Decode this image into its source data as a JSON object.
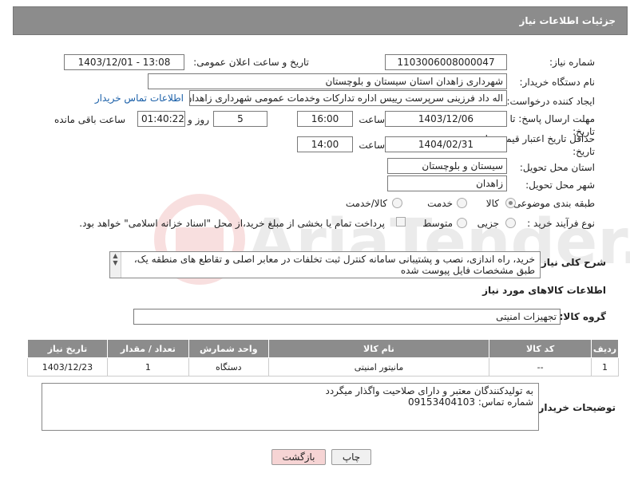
{
  "header": {
    "title": "جزئیات اطلاعات نیاز"
  },
  "fields": {
    "need_number_label": "شماره نیاز:",
    "need_number": "1103006008000047",
    "announce_label": "تاریخ و ساعت اعلان عمومی:",
    "announce_value": "1403/12/01 - 13:08",
    "buyer_label": "نام دستگاه خریدار:",
    "buyer_value": "شهرداری زاهدان استان سیستان و بلوچستان",
    "creator_label": "ایجاد کننده درخواست:",
    "creator_value": "اله داد فرزینی سرپرست رییس اداره تدارکات وخدمات عمومی شهرداری زاهدان ا",
    "contact_link": "اطلاعات تماس خریدار",
    "reply_deadline_label": "مهلت ارسال پاسخ: تا تاریخ:",
    "reply_date": "1403/12/06",
    "time_label": "ساعت",
    "reply_time": "16:00",
    "days_value": "5",
    "day_and_label": "روز و",
    "remaining_time": "01:40:22",
    "remaining_label": "ساعت باقی مانده",
    "price_validity_label": "حداقل تاریخ اعتبار قیمت: تا تاریخ:",
    "price_date": "1404/02/31",
    "price_time": "14:00",
    "province_label": "استان محل تحویل:",
    "province_value": "سیستان و بلوچستان",
    "city_label": "شهر محل تحویل:",
    "city_value": "زاهدان",
    "category_label": "طبقه بندی موضوعی:",
    "category_options": [
      "کالا",
      "خدمت",
      "کالا/خدمت"
    ],
    "category_selected": "کالا",
    "process_label": "نوع فرآیند خرید :",
    "process_options": [
      "جزیی",
      "متوسط"
    ],
    "payment_note": "پرداخت تمام یا بخشی از مبلغ خرید،از محل \"اسناد خزانه اسلامی\" خواهد بود."
  },
  "description": {
    "label": "شرح کلی نیاز:",
    "text": "خرید، راه اندازی، نصب و پشتیبانی سامانه کنترل ثبت تخلفات در معابر اصلی و تقاطع های منطقه یک، طبق مشخصات فایل پیوست شده"
  },
  "goods": {
    "section_title": "اطلاعات کالاهای مورد نیاز",
    "group_label": "گروه کالا:",
    "group_value": "تجهیزات امنیتی",
    "columns": [
      "ردیف",
      "کد کالا",
      "نام کالا",
      "واحد شمارش",
      "تعداد / مقدار",
      "تاریخ نیاز"
    ],
    "rows": [
      {
        "index": "1",
        "code": "--",
        "name": "مانیتور امنیتی",
        "unit": "دستگاه",
        "qty": "1",
        "date": "1403/12/23"
      }
    ]
  },
  "buyer_notes": {
    "label": "توضیحات خریدار:",
    "line1": "به تولیدکنندگان معتبر و دارای صلاحیت واگذار میگردد",
    "line2": "شماره تماس: 09153404103"
  },
  "buttons": {
    "print": "چاپ",
    "back": "بازگشت"
  },
  "watermark": {
    "text": "AriaTender.neT"
  }
}
